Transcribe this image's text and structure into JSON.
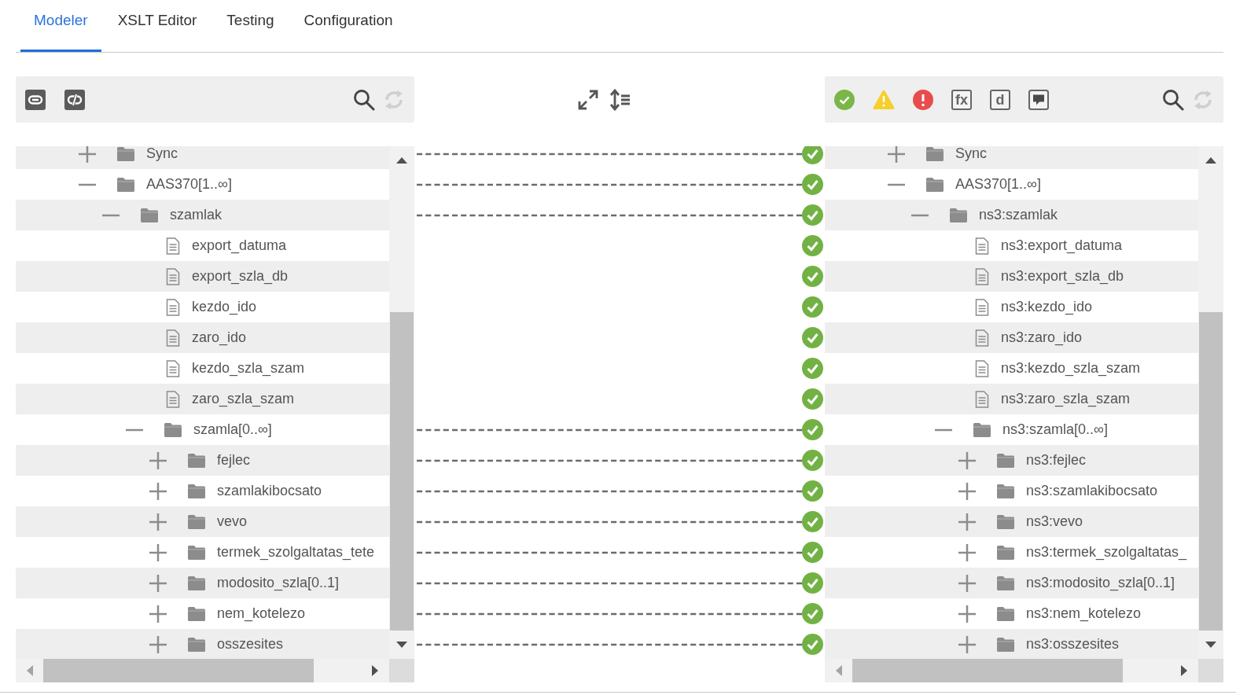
{
  "tabs": [
    {
      "label": "Modeler",
      "selected": true
    },
    {
      "label": "XSLT Editor",
      "selected": false
    },
    {
      "label": "Testing",
      "selected": false
    },
    {
      "label": "Configuration",
      "selected": false
    }
  ],
  "source_toolbar": {
    "buttons": [
      {
        "kind": "link"
      },
      {
        "kind": "unlink"
      }
    ],
    "refresh": {
      "disabled": true
    }
  },
  "target_toolbar": {
    "buttons": [
      {
        "kind": "ok"
      },
      {
        "kind": "warning"
      },
      {
        "kind": "error"
      },
      {
        "kind": "text",
        "label": "fx"
      },
      {
        "kind": "text",
        "label": "d"
      },
      {
        "kind": "comment"
      }
    ],
    "refresh": {
      "disabled": true
    }
  },
  "source_tree": [
    {
      "label": "Sync",
      "kind": "folder",
      "expanded": false
    },
    {
      "label": "AAS370[1..∞]",
      "kind": "folder",
      "expanded": true,
      "children": [
        {
          "label": "szamlak",
          "kind": "folder",
          "expanded": true,
          "children": [
            {
              "label": "export_datuma",
              "kind": "file"
            },
            {
              "label": "export_szla_db",
              "kind": "file"
            },
            {
              "label": "kezdo_ido",
              "kind": "file"
            },
            {
              "label": "zaro_ido",
              "kind": "file"
            },
            {
              "label": "kezdo_szla_szam",
              "kind": "file"
            },
            {
              "label": "zaro_szla_szam",
              "kind": "file"
            },
            {
              "label": "szamla[0..∞]",
              "kind": "folder",
              "expanded": true,
              "children": [
                {
                  "label": "fejlec",
                  "kind": "folder",
                  "expanded": false
                },
                {
                  "label": "szamlakibocsato",
                  "kind": "folder",
                  "expanded": false
                },
                {
                  "label": "vevo",
                  "kind": "folder",
                  "expanded": false
                },
                {
                  "label": "termek_szolgaltatas_tete",
                  "kind": "folder",
                  "expanded": false
                },
                {
                  "label": "modosito_szla[0..1]",
                  "kind": "folder",
                  "expanded": false
                },
                {
                  "label": "nem_kotelezo",
                  "kind": "folder",
                  "expanded": false
                },
                {
                  "label": "osszesites",
                  "kind": "folder",
                  "expanded": false
                }
              ]
            }
          ]
        }
      ]
    }
  ],
  "mappings": [
    {
      "linked": true,
      "kind": "ok"
    },
    {
      "linked": true,
      "kind": "ok"
    },
    {
      "linked": true,
      "kind": "ok"
    },
    {
      "linked": false,
      "kind": "ok"
    },
    {
      "linked": false,
      "kind": "ok"
    },
    {
      "linked": false,
      "kind": "ok"
    },
    {
      "linked": false,
      "kind": "ok"
    },
    {
      "linked": false,
      "kind": "ok"
    },
    {
      "linked": false,
      "kind": "ok"
    },
    {
      "linked": true,
      "kind": "ok"
    },
    {
      "linked": true,
      "kind": "ok"
    },
    {
      "linked": true,
      "kind": "ok"
    },
    {
      "linked": true,
      "kind": "ok"
    },
    {
      "linked": true,
      "kind": "ok"
    },
    {
      "linked": true,
      "kind": "ok"
    },
    {
      "linked": true,
      "kind": "ok"
    },
    {
      "linked": true,
      "kind": "ok"
    }
  ],
  "target_tree": [
    {
      "label": "Sync",
      "kind": "folder",
      "expanded": false
    },
    {
      "label": "AAS370[1..∞]",
      "kind": "folder",
      "expanded": true,
      "children": [
        {
          "label": "ns3:szamlak",
          "kind": "folder",
          "expanded": true,
          "children": [
            {
              "label": "ns3:export_datuma",
              "kind": "file"
            },
            {
              "label": "ns3:export_szla_db",
              "kind": "file"
            },
            {
              "label": "ns3:kezdo_ido",
              "kind": "file"
            },
            {
              "label": "ns3:zaro_ido",
              "kind": "file"
            },
            {
              "label": "ns3:kezdo_szla_szam",
              "kind": "file"
            },
            {
              "label": "ns3:zaro_szla_szam",
              "kind": "file"
            },
            {
              "label": "ns3:szamla[0..∞]",
              "kind": "folder",
              "expanded": true,
              "children": [
                {
                  "label": "ns3:fejlec",
                  "kind": "folder",
                  "expanded": false
                },
                {
                  "label": "ns3:szamlakibocsato",
                  "kind": "folder",
                  "expanded": false
                },
                {
                  "label": "ns3:vevo",
                  "kind": "folder",
                  "expanded": false
                },
                {
                  "label": "ns3:termek_szolgaltatas_",
                  "kind": "folder",
                  "expanded": false
                },
                {
                  "label": "ns3:modosito_szla[0..1]",
                  "kind": "folder",
                  "expanded": false
                },
                {
                  "label": "ns3:nem_kotelezo",
                  "kind": "folder",
                  "expanded": false
                },
                {
                  "label": "ns3:osszesites",
                  "kind": "folder",
                  "expanded": false
                }
              ]
            }
          ]
        }
      ]
    }
  ]
}
